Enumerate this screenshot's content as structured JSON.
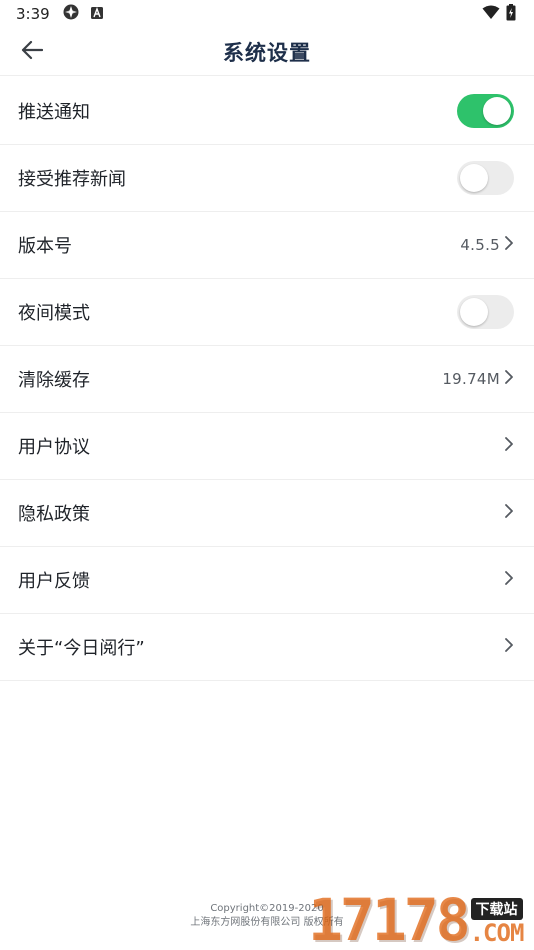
{
  "status_bar": {
    "time": "3:39",
    "icons": [
      "app-notification-icon",
      "text-notification-icon",
      "wifi-icon",
      "battery-charging-icon"
    ]
  },
  "header": {
    "title": "系统设置",
    "back_icon": "arrow-left-icon"
  },
  "settings": {
    "push_notification": {
      "label": "推送通知",
      "toggle_on": true
    },
    "recommended_news": {
      "label": "接受推荐新闻",
      "toggle_on": false
    },
    "version": {
      "label": "版本号",
      "value": "4.5.5"
    },
    "night_mode": {
      "label": "夜间模式",
      "toggle_on": false
    },
    "clear_cache": {
      "label": "清除缓存",
      "value": "19.74M"
    },
    "user_agreement": {
      "label": "用户协议"
    },
    "privacy_policy": {
      "label": "隐私政策"
    },
    "feedback": {
      "label": "用户反馈"
    },
    "about": {
      "label": "关于“今日阅行”"
    }
  },
  "footer": {
    "copyright": "Copyright©2019-2020",
    "company": "上海东方网股份有限公司 版权所有"
  },
  "watermark": {
    "digits": "17178",
    "badge": "下载站",
    "suffix": ".COM"
  },
  "colors": {
    "toggle_on": "#2ec26b",
    "toggle_off": "#ececec",
    "title": "#1e2f4a",
    "watermark": "#e06614"
  }
}
